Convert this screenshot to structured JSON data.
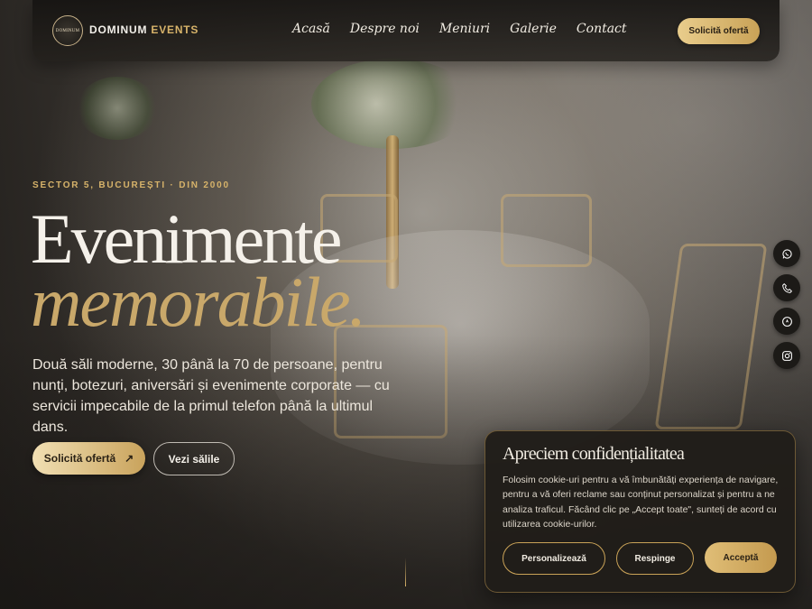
{
  "header": {
    "logo_text": "DOMINUM",
    "brand_part1": "DOMINUM",
    "brand_part2": "EVENTS",
    "nav": [
      "Acasă",
      "Despre noi",
      "Meniuri",
      "Galerie",
      "Contact"
    ],
    "cta_label": "Solicită ofertă"
  },
  "hero": {
    "eyebrow": "SECTOR 5, BUCUREȘTI · DIN 2000",
    "title_line1": "Evenimente",
    "title_line2": "memorabile.",
    "lead": "Două săli moderne, 30 până la 70 de persoane, pentru nunți, botezuri, aniversări și evenimente corporate — cu servicii impecabile de la primul telefon până la ultimul dans.",
    "primary_button": "Solicită ofertă",
    "primary_button_icon": "↗",
    "secondary_button": "Vezi sălile"
  },
  "social": [
    "whatsapp-icon",
    "phone-icon",
    "location-icon",
    "instagram-icon"
  ],
  "cookie": {
    "title": "Apreciem confidențialitatea",
    "text": "Folosim cookie-uri pentru a vă îmbunătăți experiența de navigare, pentru a vă oferi reclame sau conținut personalizat și pentru a ne analiza traficul. Făcând clic pe „Accept toate\", sunteți de acord cu utilizarea cookie-urilor.",
    "personalize": "Personalizează",
    "reject": "Respinge",
    "accept": "Acceptă"
  },
  "colors": {
    "accent_gold": "#d7b36a",
    "button_gold": "#c9a257",
    "panel_dark": "#201d19"
  }
}
